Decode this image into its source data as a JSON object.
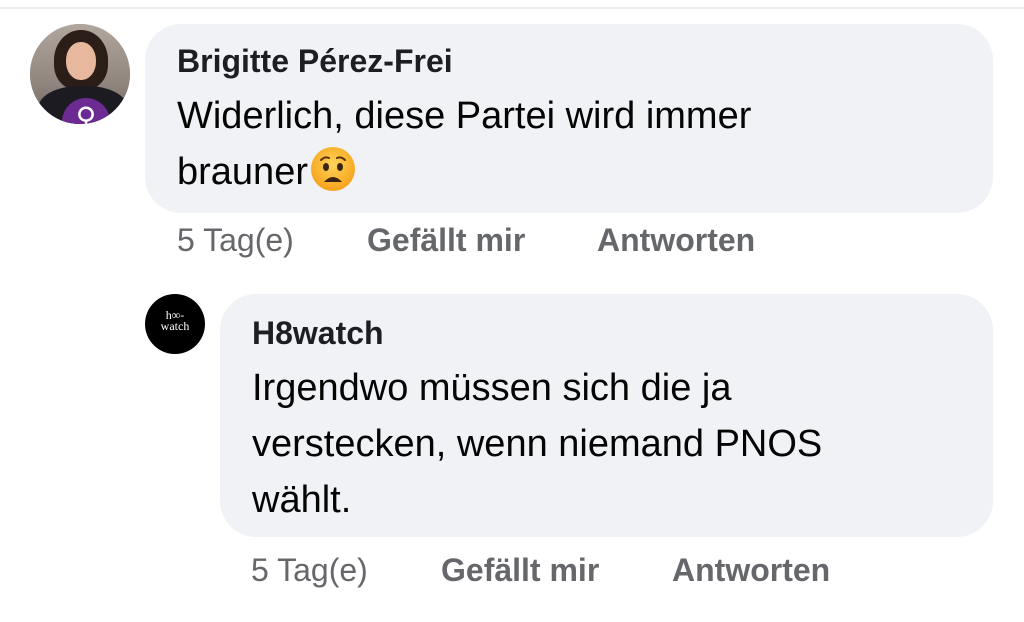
{
  "comments": [
    {
      "author": "Brigitte Pérez-Frei",
      "text": "Widerlich, diese Partei wird immer\nbrauner",
      "emoji": "worried-face",
      "avatar_badge": "♀",
      "time": "5 Tag(e)",
      "like_label": "Gefällt mir",
      "reply_label": "Antworten"
    },
    {
      "author": "H8watch",
      "text": "Irgendwo müssen sich die ja\nverstecken, wenn niemand PNOS\nwählt.",
      "avatar_logo_line1": "h∞-",
      "avatar_logo_line2": "watch",
      "time": "5 Tag(e)",
      "like_label": "Gefällt mir",
      "reply_label": "Antworten"
    }
  ],
  "colors": {
    "bubble_bg": "#f0f2f5",
    "author_text": "#1c1e21",
    "meta_text": "#65676b",
    "badge": "#6c2b93"
  }
}
